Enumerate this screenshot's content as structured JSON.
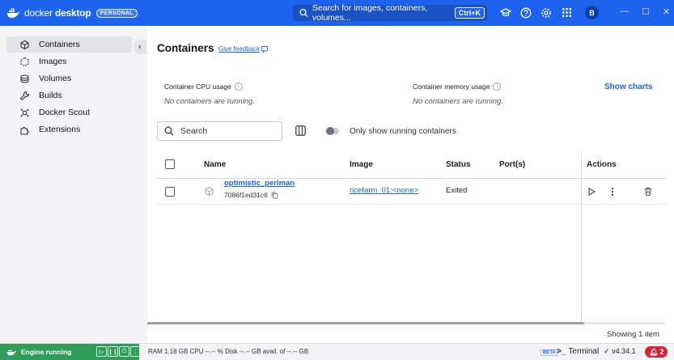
{
  "app": {
    "brand_regular": "docker ",
    "brand_bold": "desktop",
    "plan_badge": "PERSONAL",
    "brand_color": "#1d63ed"
  },
  "global_search": {
    "placeholder": "Search for images, containers, volumes...",
    "shortcut": "Ctrl+K"
  },
  "topbar_icons": [
    "learning-center-icon",
    "help-icon",
    "settings-icon",
    "grid-icon"
  ],
  "user": {
    "avatar_initial": "B"
  },
  "sidebar": {
    "items": [
      {
        "label": "Containers",
        "icon": "container-icon",
        "active": true
      },
      {
        "label": "Images",
        "icon": "images-icon",
        "active": false
      },
      {
        "label": "Volumes",
        "icon": "volumes-icon",
        "active": false
      },
      {
        "label": "Builds",
        "icon": "builds-icon",
        "active": false
      },
      {
        "label": "Docker Scout",
        "icon": "scout-icon",
        "active": false
      },
      {
        "label": "Extensions",
        "icon": "extensions-icon",
        "active": false
      }
    ]
  },
  "main": {
    "title": "Containers",
    "feedback_link": "Give feedback",
    "cpu": {
      "label": "Container CPU usage",
      "value": "No containers are running."
    },
    "memory": {
      "label": "Container memory usage",
      "value": "No containers are running."
    },
    "show_charts": "Show charts",
    "search": {
      "placeholder": "Search"
    },
    "running_toggle": {
      "label": "Only show running containers",
      "on": false
    },
    "table": {
      "columns": [
        "Name",
        "Image",
        "Status",
        "Port(s)",
        "Actions"
      ],
      "rows": [
        {
          "name": "optimistic_perlman",
          "id": "7086f1ed31c6",
          "image": "ricefarm_01:<none>",
          "status": "Exited",
          "ports": ""
        }
      ]
    },
    "showing": "Showing 1 item"
  },
  "footer": {
    "engine_status": "Engine running",
    "engine_color": "#2f9e5b",
    "resources": "RAM 1.18 GB  CPU --.-- %   Disk --.-- GB avail. of --.-- GB",
    "beta": "BETA",
    "terminal": "Terminal",
    "version": "v4.34.1",
    "notifications": "2",
    "notification_color": "#d3243a"
  }
}
